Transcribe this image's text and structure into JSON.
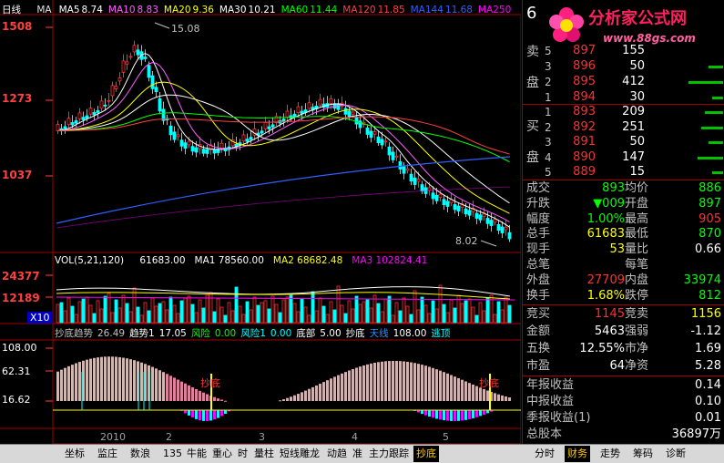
{
  "chart": {
    "period_label": "日线",
    "ma_labels": [
      {
        "name": "MA",
        "value": "",
        "color": "#e0e0e0"
      },
      {
        "name": "MA5",
        "value": "8.74",
        "color": "#ffffff"
      },
      {
        "name": "MA10",
        "value": "8.83",
        "color": "#ff60ff"
      },
      {
        "name": "MA20",
        "value": "9.36",
        "color": "#ffff00"
      },
      {
        "name": "MA30",
        "value": "10.21",
        "color": "#ffffff"
      },
      {
        "name": "MA60",
        "value": "11.44",
        "color": "#00ff00"
      },
      {
        "name": "MA120",
        "value": "11.85",
        "color": "#ff4040"
      },
      {
        "name": "MA144",
        "value": "11.68",
        "color": "#3060ff"
      },
      {
        "name": "MA250",
        "value": "",
        "color": "#ff00ff"
      }
    ],
    "price_axis": [
      "1508",
      "1273",
      "1037"
    ],
    "high_annotation": "15.08",
    "low_annotation": "8.02",
    "volume_title": "VOL(5,21,120)",
    "volume_vals": [
      {
        "text": "61683.00",
        "color": "#ffffff"
      },
      {
        "text": "MA1 78560.00",
        "color": "#ffffff"
      },
      {
        "text": "MA2 68682.48",
        "color": "#ffff00"
      },
      {
        "text": "MA3 102824.41",
        "color": "#ff00ff"
      }
    ],
    "volume_axis": [
      "24377",
      "12189"
    ],
    "volume_unit": "X10",
    "indicator_title": [
      {
        "text": "抄底趋势",
        "color": "#c0c0c0"
      },
      {
        "text": "26.49",
        "color": "#c0c0c0"
      },
      {
        "text": "趋势1",
        "color": "#ffffff"
      },
      {
        "text": "17.05",
        "color": "#ffffff"
      },
      {
        "text": "风险",
        "color": "#00ff00"
      },
      {
        "text": "0.00",
        "color": "#00ff00"
      },
      {
        "text": "风险1",
        "color": "#00ffff"
      },
      {
        "text": "0.00",
        "color": "#00ffff"
      },
      {
        "text": "底部",
        "color": "#ffffff"
      },
      {
        "text": "5.00",
        "color": "#ffffff"
      },
      {
        "text": "抄底",
        "color": "#ffffff"
      },
      {
        "text": "天线",
        "color": "#3090ff"
      },
      {
        "text": "108.00",
        "color": "#ffffff"
      },
      {
        "text": "逃顶",
        "color": "#00ffff"
      }
    ],
    "indicator_axis": [
      "108.00",
      "62.31",
      "16.62"
    ],
    "signal_label": "抄底",
    "x_labels": [
      "2010",
      "2",
      "3",
      "4",
      "5"
    ]
  },
  "quote": {
    "code_prefix": "6",
    "sell_label": [
      "卖",
      "盘"
    ],
    "buy_label": [
      "买",
      "盘"
    ],
    "sells": [
      {
        "idx": "5",
        "price": "897",
        "vol": "155"
      },
      {
        "idx": "3",
        "price": "896",
        "vol": "50"
      },
      {
        "idx": "2",
        "price": "895",
        "vol": "412"
      },
      {
        "idx": "1",
        "price": "894",
        "vol": "30"
      }
    ],
    "buys": [
      {
        "idx": "1",
        "price": "893",
        "vol": "209"
      },
      {
        "idx": "2",
        "price": "892",
        "vol": "251"
      },
      {
        "idx": "3",
        "price": "891",
        "vol": "50"
      },
      {
        "idx": "4",
        "price": "890",
        "vol": "147"
      },
      {
        "idx": "5",
        "price": "889",
        "vol": "15"
      }
    ],
    "stats": [
      {
        "l1": "成交",
        "v1": "893",
        "c1": "#00ff00",
        "l2": "均价",
        "v2": "886",
        "c2": "#00ff00"
      },
      {
        "l1": "升跌",
        "v1": "▼009",
        "c1": "#00ff00",
        "l2": "开盘",
        "v2": "897",
        "c2": "#00ff00"
      },
      {
        "l1": "幅度",
        "v1": "1.00%",
        "c1": "#00ff00",
        "l2": "最高",
        "v2": "905",
        "c2": "#ff3030"
      },
      {
        "l1": "总手",
        "v1": "61683",
        "c1": "#ffff00",
        "l2": "最低",
        "v2": "870",
        "c2": "#00ff00"
      },
      {
        "l1": "现手",
        "v1": "53",
        "c1": "#ffff00",
        "l2": "量比",
        "v2": "0.66",
        "c2": "#ffffff"
      },
      {
        "l1": "总笔",
        "v1": "",
        "c1": "#ffffff",
        "l2": "每笔",
        "v2": "",
        "c2": "#ffffff"
      },
      {
        "l1": "外盘",
        "v1": "27709",
        "c1": "#ff3030",
        "l2": "内盘",
        "v2": "33974",
        "c2": "#00ff00"
      },
      {
        "l1": "换手",
        "v1": "1.68%",
        "c1": "#ffff00",
        "l2": "跌停",
        "v2": "812",
        "c2": "#00ff00"
      }
    ],
    "stats2": [
      {
        "l1": "竞买",
        "v1": "1145",
        "c1": "#ff3030",
        "l2": "竞卖",
        "v2": "1156",
        "c2": "#ffff00"
      },
      {
        "l1": "金额",
        "v1": "5463",
        "c1": "#ffffff",
        "l2": "强弱",
        "v2": "-1.12",
        "c2": "#ffffff"
      },
      {
        "l1": "五换",
        "v1": "12.55%",
        "c1": "#ffffff",
        "l2": "市净",
        "v2": "1.69",
        "c2": "#ffffff"
      },
      {
        "l1": "市盈",
        "v1": "64",
        "c1": "#ffffff",
        "l2": "净资",
        "v2": "5.28",
        "c2": "#ffffff"
      }
    ],
    "reports": [
      {
        "label": "年报收益",
        "value": "0.14"
      },
      {
        "label": "中报收益",
        "value": "0.10"
      },
      {
        "label": "季报收益(1)",
        "value": "0.01"
      },
      {
        "label": "总股本",
        "value": "36897万"
      }
    ]
  },
  "logo": {
    "title": "分析家公式网",
    "url": "www.88gs.com"
  },
  "bottom_tabs": {
    "left": [
      "坐标",
      "监庄",
      "数浪",
      "135",
      "牛能",
      "重心",
      "时",
      "量柱",
      "短线雕龙",
      "动趋",
      "准",
      "主力跟踪",
      "抄底"
    ],
    "active_left": "抄底",
    "right": [
      "分时",
      "财务",
      "走势",
      "筹码",
      "诊断"
    ],
    "active_right": "财务"
  }
}
